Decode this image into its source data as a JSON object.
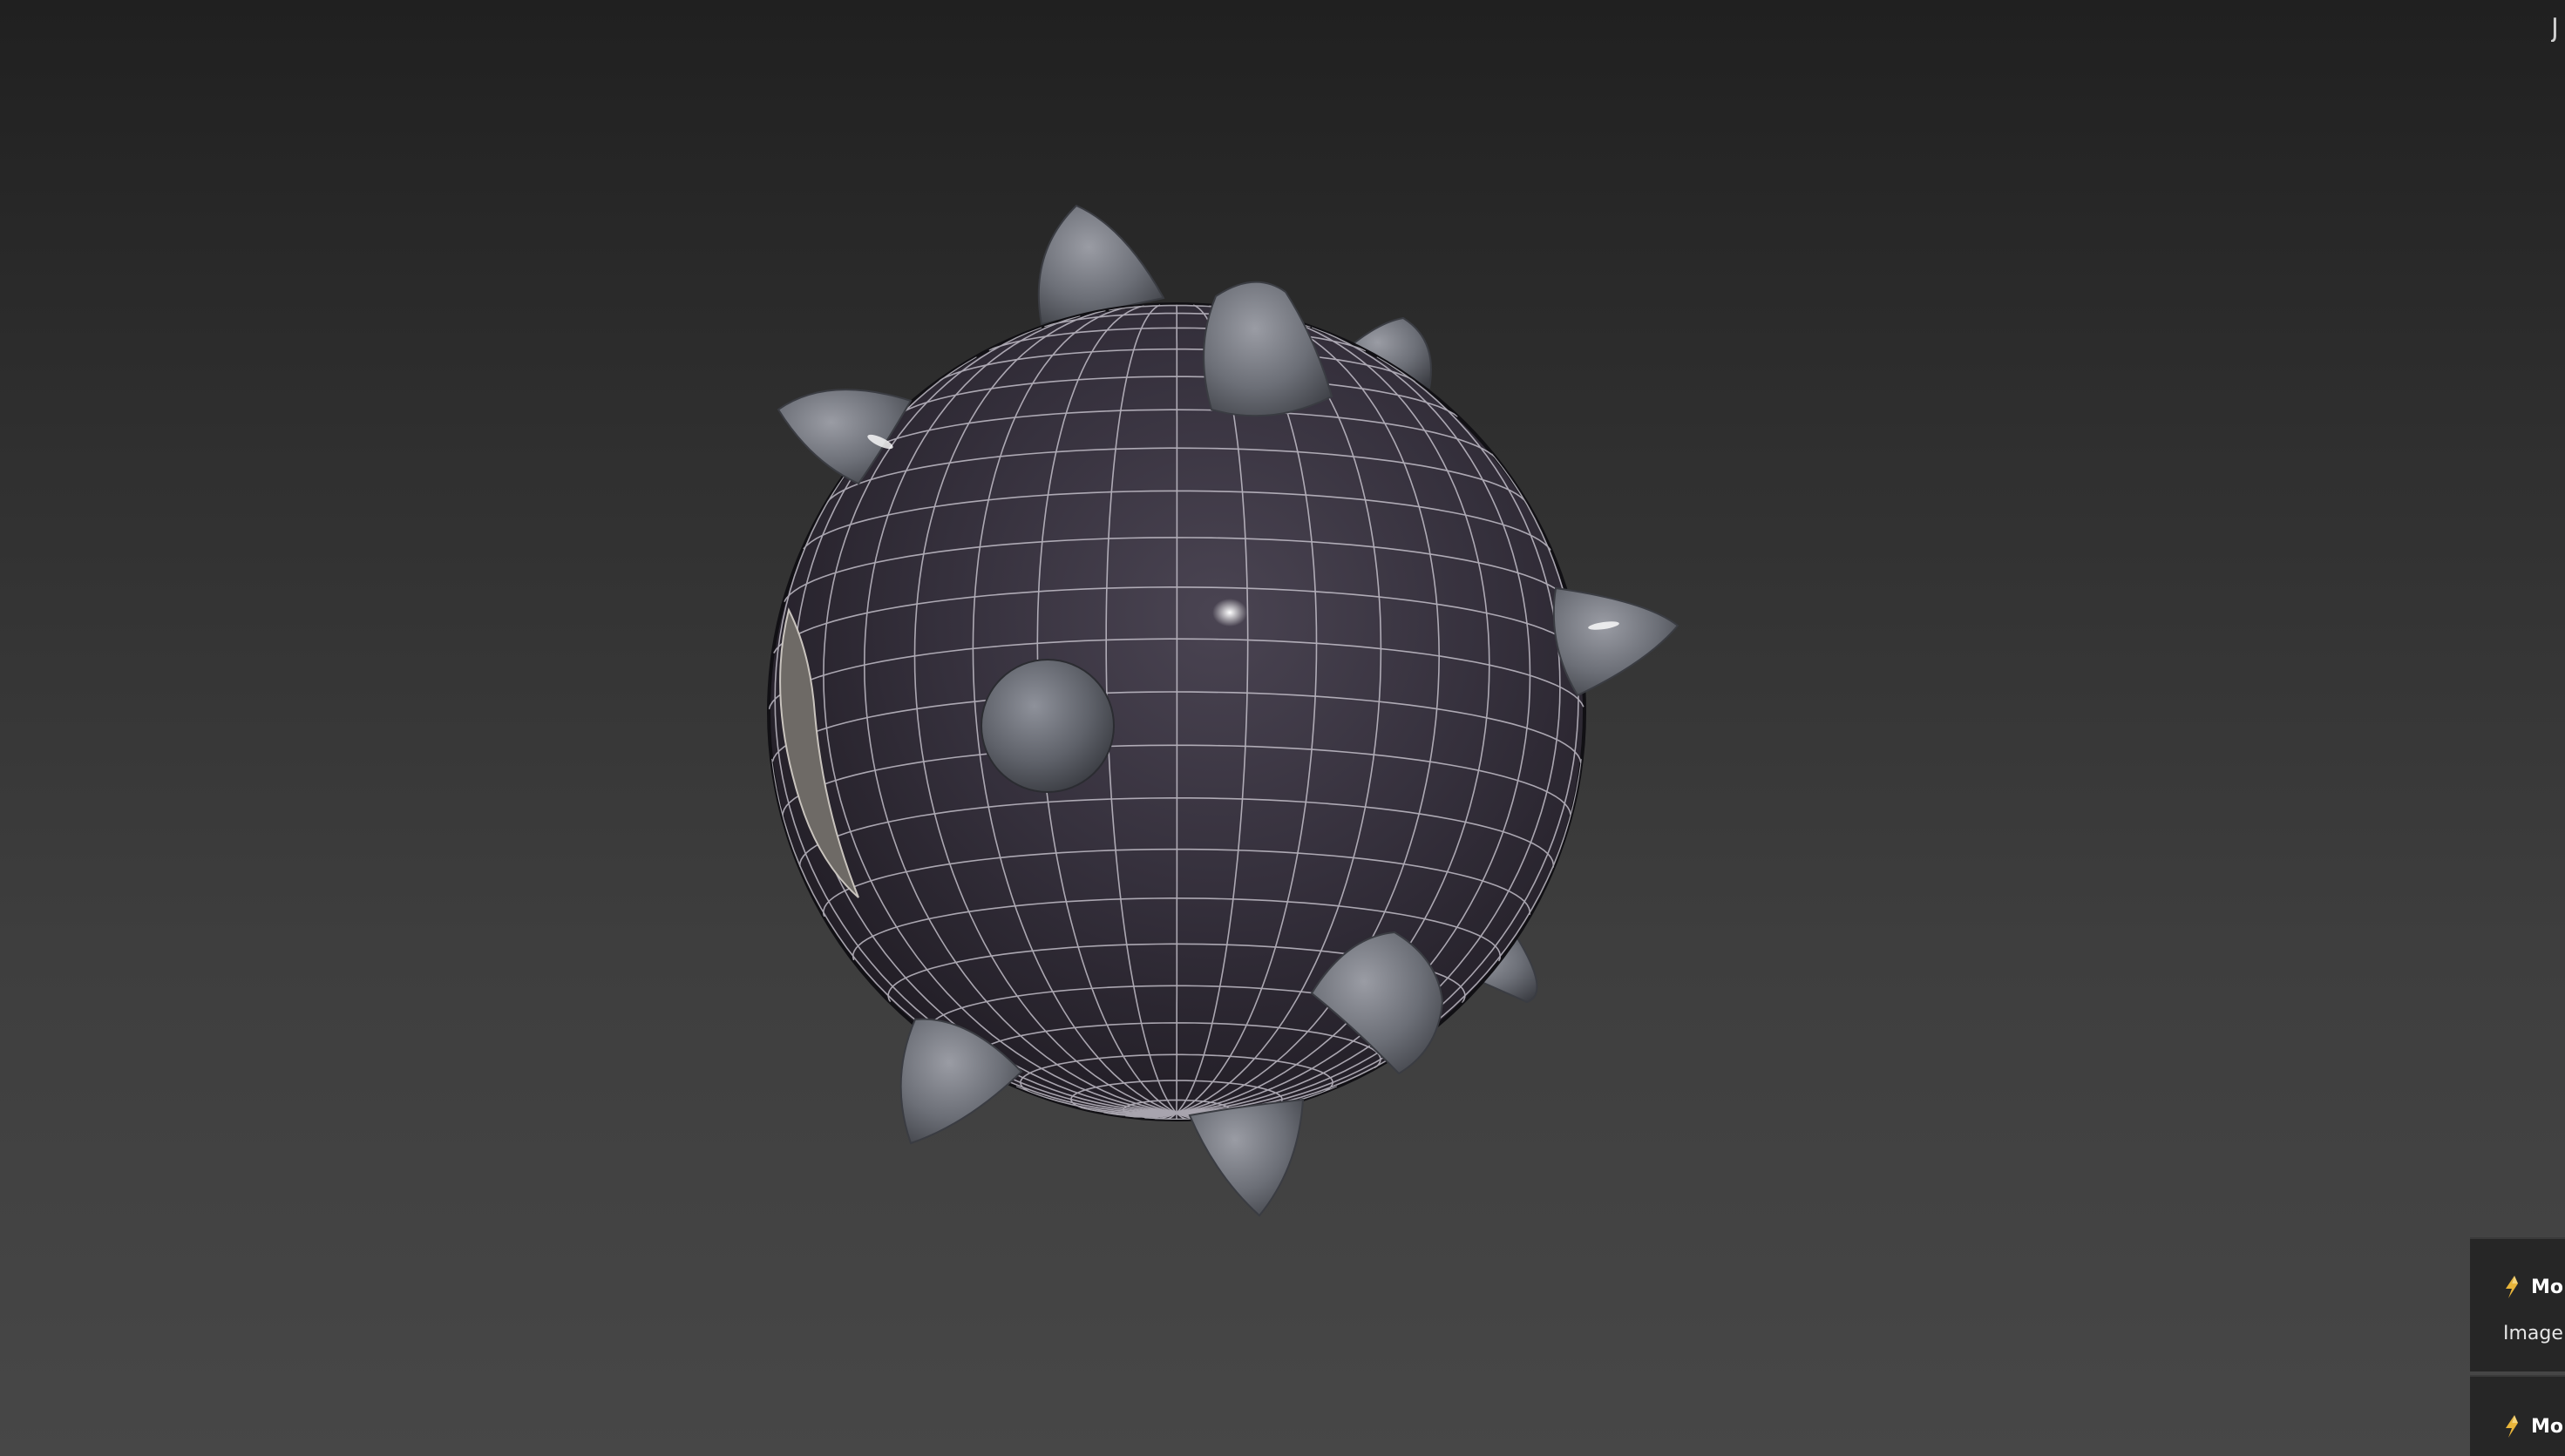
{
  "viewport": {
    "background_top": "#202020",
    "background_bottom": "#474747",
    "corner_glyph": "J"
  },
  "model": {
    "description_icon": "spiked-sphere-wireframe",
    "body_color": "#2f2a34",
    "wire_color": "#d6d2dc",
    "spike_color": "#6f727a"
  },
  "notifications": [
    {
      "icon": "lightning-bolt-icon",
      "title": "Mo",
      "body": "Image c"
    },
    {
      "icon": "lightning-bolt-icon",
      "title": "Mo",
      "body": ""
    }
  ]
}
